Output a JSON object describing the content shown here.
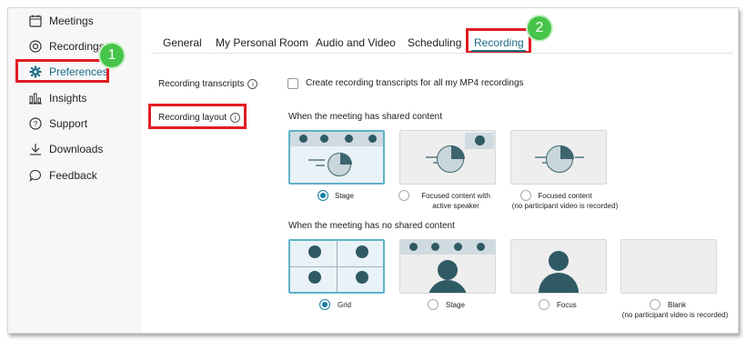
{
  "sidebar": {
    "items": [
      {
        "label": "Meetings",
        "icon": "calendar-icon"
      },
      {
        "label": "Recordings",
        "icon": "record-icon"
      },
      {
        "label": "Preferences",
        "icon": "gear-icon",
        "active": true
      },
      {
        "label": "Insights",
        "icon": "bar-chart-icon"
      },
      {
        "label": "Support",
        "icon": "help-icon"
      },
      {
        "label": "Downloads",
        "icon": "download-icon"
      },
      {
        "label": "Feedback",
        "icon": "chat-bubble-icon"
      }
    ]
  },
  "badges": {
    "step1": "1",
    "step2": "2"
  },
  "tabs": [
    {
      "label": "General"
    },
    {
      "label": "My Personal Room"
    },
    {
      "label": "Audio and Video"
    },
    {
      "label": "Scheduling"
    },
    {
      "label": "Recording",
      "active": true
    }
  ],
  "settings": {
    "transcripts_label": "Recording transcripts",
    "transcripts_checkbox_text": "Create recording transcripts for all my MP4 recordings",
    "transcripts_checked": false,
    "layout_label": "Recording layout",
    "shared_title": "When the meeting has shared content",
    "no_shared_title": "When the meeting has no shared content",
    "shared_options": [
      {
        "label": "Stage",
        "selected": true
      },
      {
        "label_line1": "Focused content with",
        "label_line2": "active speaker",
        "selected": false
      },
      {
        "label_line1": "Focused content",
        "label_line2": "(no participant video is recorded)",
        "selected": false
      }
    ],
    "no_shared_options": [
      {
        "label": "Grid",
        "selected": true
      },
      {
        "label": "Stage",
        "selected": false
      },
      {
        "label": "Focus",
        "selected": false
      },
      {
        "label_line1": "Blank",
        "label_line2": "(no participant video is recorded)",
        "selected": false
      }
    ]
  },
  "colors": {
    "accent": "#1a6b86",
    "highlight": "#e21b24",
    "badge": "#47c44a"
  }
}
